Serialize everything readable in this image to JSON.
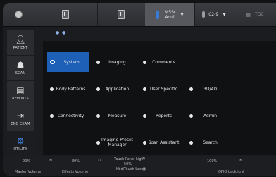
{
  "topbar": {
    "probe_model": "M5Sc",
    "probe_preset": "Adult",
    "transducer": "C2-9",
    "right_item": "TGC"
  },
  "nav": [
    {
      "label": "PATIENT"
    },
    {
      "label": "SCAN"
    },
    {
      "label": "REPORTS"
    },
    {
      "label": "END EXAM"
    },
    {
      "label": "UTILITY"
    }
  ],
  "panel": {
    "page_indicator": "● ●",
    "buttons": [
      {
        "label": "System",
        "selected": true
      },
      {
        "label": "Imaging"
      },
      {
        "label": "Comments"
      },
      {
        "label": "Body Patterns"
      },
      {
        "label": "Application"
      },
      {
        "label": "User Specific"
      },
      {
        "label": "3D/4D"
      },
      {
        "label": "Connectivity"
      },
      {
        "label": "Measure"
      },
      {
        "label": "Reports"
      },
      {
        "label": "Admin"
      },
      {
        "label": "Imaging Preset Manager"
      },
      {
        "label": "Scan Assistant"
      },
      {
        "label": "Search"
      }
    ]
  },
  "bottombar": {
    "master_volume_value": "90%",
    "master_volume_label": "Master Volume",
    "effects_volume_value": "80%",
    "effects_volume_label": "Effects Volume",
    "touch_panel_label": "Touch Panel Light",
    "touch_panel_value": "50%",
    "kbd_lock_label": "Kbd/Touch Lock",
    "opio_value": "100%",
    "opio_label": "OPIO backlight"
  },
  "colors": {
    "selected_button": "#1e5fb8",
    "utility_icon": "#3f86e8"
  }
}
